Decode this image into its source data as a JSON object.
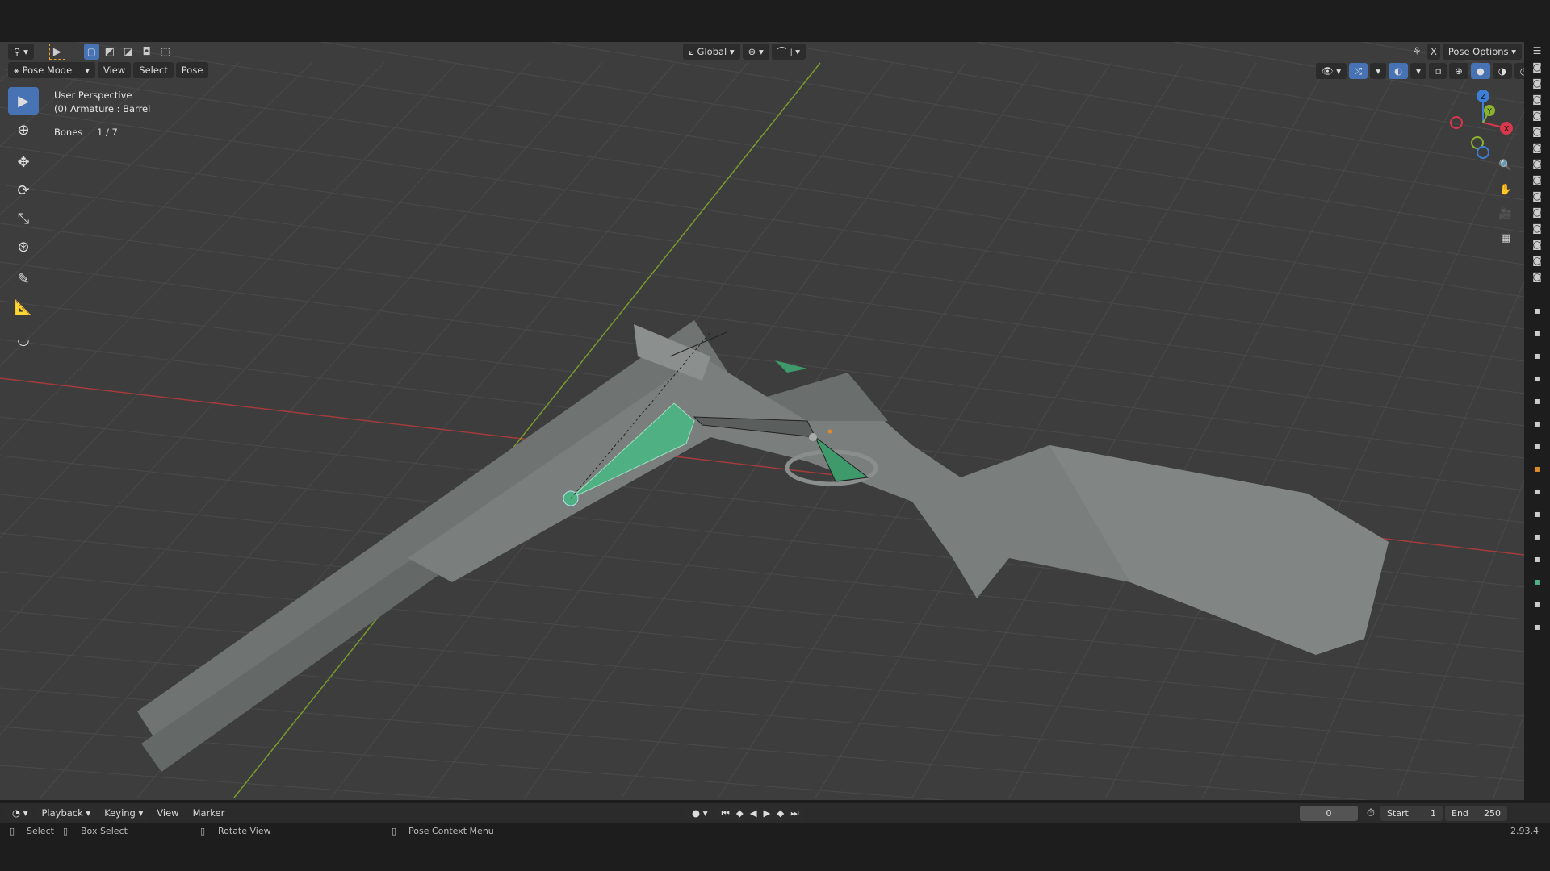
{
  "header": {
    "mode": "Pose Mode",
    "menus": [
      "View",
      "Select",
      "Pose"
    ],
    "transform_orientation": "Global",
    "pose_options": "Pose Options",
    "x_mirror": "X"
  },
  "overlay": {
    "perspective": "User Perspective",
    "object": "(0) Armature : Barrel",
    "stat_label": "Bones",
    "stat_value": "1 / 7"
  },
  "gizmo": {
    "z": "Z",
    "y": "Y",
    "x": "X"
  },
  "tools": [
    "select-box",
    "cursor",
    "move",
    "rotate",
    "scale",
    "transform",
    "annotate",
    "measure",
    "bone-envelope"
  ],
  "timeline": {
    "menus": [
      "Playback",
      "Keying",
      "View",
      "Marker"
    ],
    "current_frame": "0",
    "start_label": "Start",
    "start": "1",
    "end_label": "End",
    "end": "250"
  },
  "status": {
    "select": "Select",
    "box_select": "Box Select",
    "rotate_view": "Rotate View",
    "context_menu": "Pose Context Menu",
    "version": "2.93.4"
  },
  "colors": {
    "accent": "#4772b3",
    "bone_selected": "#4fb083",
    "x_axis": "#b23a3a",
    "y_axis": "#7fa32c"
  }
}
